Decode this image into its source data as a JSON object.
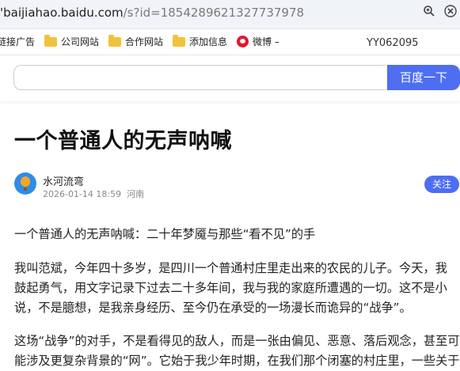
{
  "address_bar": {
    "url_host": "'baijiahao.baidu.com",
    "url_path": "/s?id=1854289621327737978",
    "zoom_icon": "zoom-icon",
    "close_icon": "close-icon"
  },
  "bookmarks": {
    "items": [
      {
        "label": "链接广告",
        "icon": "none"
      },
      {
        "label": "公司网站",
        "icon": "folder-icon"
      },
      {
        "label": "合作网站",
        "icon": "folder-icon"
      },
      {
        "label": "添加信息",
        "icon": "folder-icon"
      },
      {
        "label": "微博 –",
        "icon": "weibo-icon"
      }
    ],
    "code": "YY062095"
  },
  "search": {
    "value": "",
    "button_label": "百度一下"
  },
  "article": {
    "title": "一个普通人的无声呐喊",
    "author": "水河流弯",
    "date": "2026-01-14 18:59",
    "location": "河南",
    "follow_label": "关注",
    "paragraphs": [
      [
        "一个普通人的无声呐喊：二十年梦魇与那些“看不见”的手"
      ],
      [
        "我叫范斌，今年四十多岁，是四川一个普通村庄里走出来的农民的儿子。今天，我",
        "鼓起勇气，用文字记录下过去二十多年间，我与我的家庭所遭遇的一切。这不是小",
        "说，不是臆想，是我亲身经历、至今仍在承受的一场漫长而诡异的“战争”。"
      ],
      [
        "这场“战争”的对手，不是看得见的敌人，而是一张由偏见、恶意、落后观念，甚至可",
        "能涉及更复杂背景的“网”。它始于我少年时期，在我们那个闭塞的村庄里，一些关于"
      ]
    ]
  }
}
